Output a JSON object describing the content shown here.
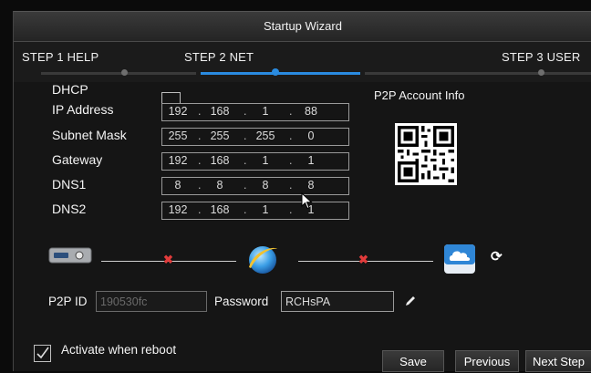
{
  "title": "Startup Wizard",
  "steps": [
    {
      "label": "STEP 1 HELP"
    },
    {
      "label": "STEP 2 NET"
    },
    {
      "label": "STEP 3 USER"
    }
  ],
  "net": {
    "dhcp_label": "DHCP",
    "dhcp_checked": false,
    "ip_label": "IP Address",
    "ip": [
      "192",
      "168",
      "1",
      "88"
    ],
    "mask_label": "Subnet Mask",
    "mask": [
      "255",
      "255",
      "255",
      "0"
    ],
    "gw_label": "Gateway",
    "gw": [
      "192",
      "168",
      "1",
      "1"
    ],
    "dns1_label": "DNS1",
    "dns1": [
      "8",
      "8",
      "8",
      "8"
    ],
    "dns2_label": "DNS2",
    "dns2": [
      "192",
      "168",
      "1",
      "1"
    ]
  },
  "p2p": {
    "title": "P2P Account Info",
    "id_label": "P2P ID",
    "id_value": "190530fc",
    "password_label": "Password",
    "password_value": "RCHsPA"
  },
  "activate_label": "Activate when reboot",
  "activate_checked": true,
  "buttons": {
    "save": "Save",
    "previous": "Previous",
    "next": "Next Step"
  },
  "icons": {
    "recorder": "dvr-device-icon",
    "internet": "internet-globe-icon",
    "cloud": "cloud-icon",
    "refresh": "refresh-icon",
    "edit": "pencil-edit-icon",
    "status_fail": "disconnected-x-icon"
  },
  "colors": {
    "accent": "#2a8be0",
    "error": "#e23b3b"
  }
}
